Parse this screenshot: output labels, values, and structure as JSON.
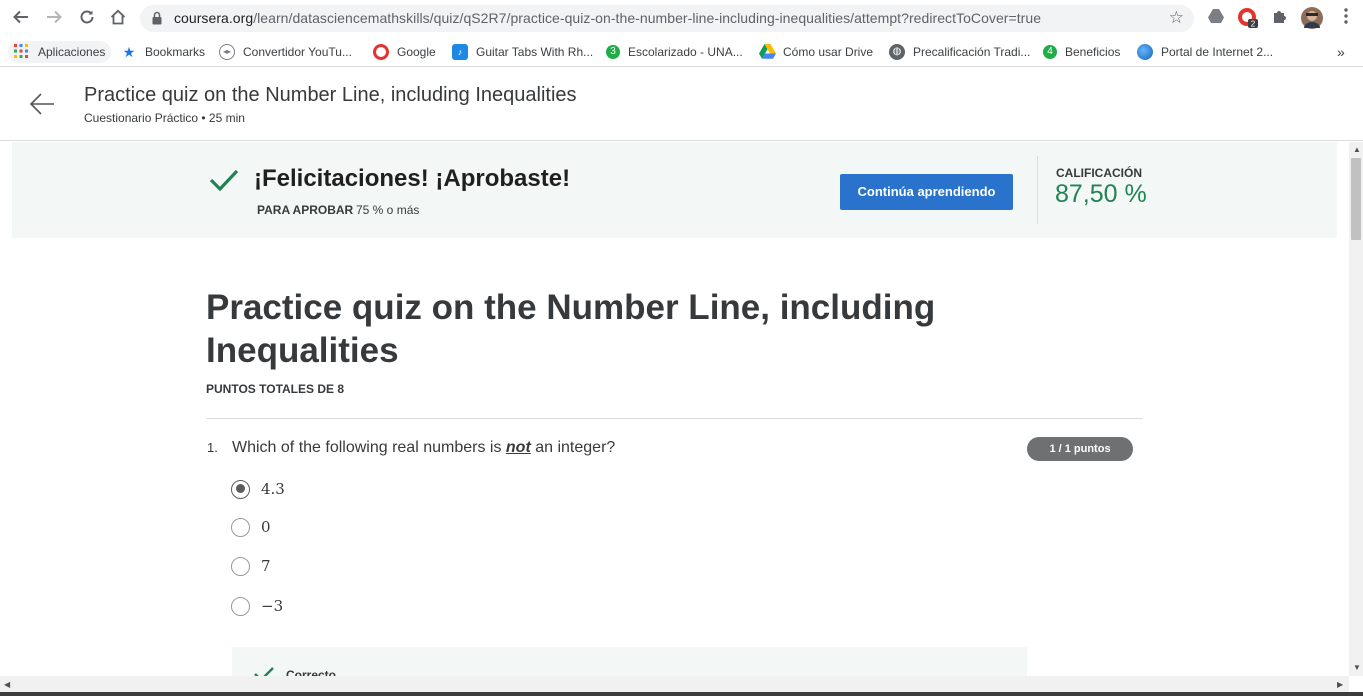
{
  "browser": {
    "url_host": "coursera.org",
    "url_path": "/learn/datasciencemathskills/quiz/qS2R7/practice-quiz-on-the-number-line-including-inequalities/attempt?redirectToCover=true",
    "ext_badge": "2"
  },
  "bookmarks": [
    {
      "label": "Aplicaciones",
      "icon": "apps-grid-icon",
      "color": "#ea4335"
    },
    {
      "label": "Bookmarks",
      "icon": "star-icon",
      "color": "#1a73e8"
    },
    {
      "label": "Convertidor YouTu...",
      "icon": "converter-icon",
      "color": "#5f6368"
    },
    {
      "label": "Google",
      "icon": "opera-icon",
      "color": "#e3342f"
    },
    {
      "label": "Guitar Tabs With Rh...",
      "icon": "tabs-icon",
      "color": "#1e88e5"
    },
    {
      "label": "Escolarizado - UNA...",
      "icon": "badge-3-icon",
      "color": "#1fad46",
      "badge": "3"
    },
    {
      "label": "Cómo usar Drive",
      "icon": "drive-icon",
      "color": "#fbbc04"
    },
    {
      "label": "Precalificación Tradi...",
      "icon": "globe-icon",
      "color": "#5f6368"
    },
    {
      "label": "Beneficios",
      "icon": "badge-4-icon",
      "color": "#1fad46",
      "badge": "4"
    },
    {
      "label": "Portal de Internet 2...",
      "icon": "earth-icon",
      "color": "#1e88e5"
    }
  ],
  "header": {
    "title": "Practice quiz on the Number Line, including Inequalities",
    "subtitle": "Cuestionario Práctico • 25 min"
  },
  "banner": {
    "message": "¡Felicitaciones! ¡Aprobaste!",
    "pass_label": "PARA APROBAR",
    "pass_value": "75 % o más",
    "continue_button": "Continúa aprendiendo",
    "grade_label": "CALIFICACIÓN",
    "grade_value": "87,50 %"
  },
  "quiz": {
    "title": "Practice quiz on the Number Line, including Inequalities",
    "total_points": "PUNTOS TOTALES DE 8",
    "question": {
      "number": "1.",
      "text_before": "Which of the following real numbers is ",
      "text_emph": "not",
      "text_after": " an integer?",
      "points": "1 / 1 puntos",
      "options": [
        {
          "label": "4.3",
          "selected": true
        },
        {
          "label": "0",
          "selected": false
        },
        {
          "label": "7",
          "selected": false
        },
        {
          "label": "−3",
          "selected": false
        }
      ],
      "feedback": "Correcto"
    }
  },
  "colors": {
    "accent_blue": "#2a73cc",
    "success_green": "#1f8354",
    "banner_bg": "#f3f8f6"
  }
}
